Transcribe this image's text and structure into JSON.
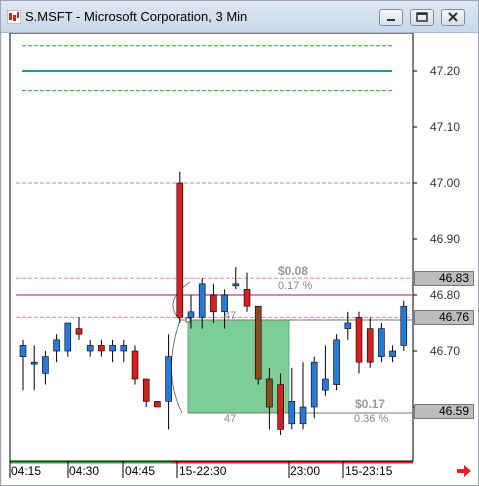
{
  "window": {
    "title": "S.MSFT - Microsoft Corporation, 3 Min"
  },
  "price_axis": {
    "labels": [
      "47.20",
      "47.10",
      "47.00",
      "46.90",
      "46.80",
      "46.70"
    ],
    "tags": {
      "upper": "46.83",
      "current": "46.76",
      "lower": "46.59"
    }
  },
  "time_axis": {
    "labels": [
      "04:15",
      "04:30",
      "04:45",
      "15-22:30",
      "23:00",
      "15-23:15"
    ]
  },
  "annotations": {
    "upper_move": "$0.08",
    "upper_pct": "0.17 %",
    "lower_move": "$0.17",
    "lower_pct": "0.36 %",
    "box_top": "47",
    "box_bottom": "47"
  },
  "colors": {
    "up": "#2878d8",
    "down": "#d42020",
    "dark_down": "#8b4a20",
    "green_line": "#22aa22",
    "teal_line": "#10a0a0",
    "pink_line": "#e080c8",
    "box_fill": "#7ccd97"
  },
  "chart_data": {
    "type": "candlestick",
    "ylim": [
      46.55,
      47.25
    ],
    "reference_lines": [
      {
        "price": 47.245,
        "color": "green",
        "style": "dashed"
      },
      {
        "price": 47.2,
        "color": "teal",
        "style": "solid"
      },
      {
        "price": 47.165,
        "color": "green",
        "style": "dashed"
      },
      {
        "price": 47.0,
        "color": "gray",
        "style": "dashed"
      },
      {
        "price": 46.83,
        "color": "pink",
        "style": "dashed"
      },
      {
        "price": 46.8,
        "color": "pink",
        "style": "solid"
      },
      {
        "price": 46.76,
        "color": "pink",
        "style": "dashed"
      }
    ],
    "candles": [
      {
        "o": 46.69,
        "h": 46.72,
        "l": 46.63,
        "c": 46.71
      },
      {
        "o": 46.68,
        "h": 46.71,
        "l": 46.63,
        "c": 46.68
      },
      {
        "o": 46.66,
        "h": 46.7,
        "l": 46.64,
        "c": 46.69
      },
      {
        "o": 46.7,
        "h": 46.73,
        "l": 46.68,
        "c": 46.72
      },
      {
        "o": 46.7,
        "h": 46.75,
        "l": 46.69,
        "c": 46.75
      },
      {
        "o": 46.74,
        "h": 46.76,
        "l": 46.72,
        "c": 46.73
      },
      {
        "o": 46.7,
        "h": 46.72,
        "l": 46.69,
        "c": 46.71
      },
      {
        "o": 46.71,
        "h": 46.72,
        "l": 46.69,
        "c": 46.7
      },
      {
        "o": 46.7,
        "h": 46.72,
        "l": 46.68,
        "c": 46.71
      },
      {
        "o": 46.7,
        "h": 46.72,
        "l": 46.68,
        "c": 46.71
      },
      {
        "o": 46.7,
        "h": 46.71,
        "l": 46.64,
        "c": 46.65
      },
      {
        "o": 46.65,
        "h": 46.65,
        "l": 46.6,
        "c": 46.61
      },
      {
        "o": 46.61,
        "h": 46.61,
        "l": 46.6,
        "c": 46.6
      },
      {
        "o": 46.61,
        "h": 46.73,
        "l": 46.56,
        "c": 46.69
      },
      {
        "o": 47.0,
        "h": 47.02,
        "l": 46.75,
        "c": 46.76
      },
      {
        "o": 46.76,
        "h": 46.8,
        "l": 46.74,
        "c": 46.77
      },
      {
        "o": 46.76,
        "h": 46.83,
        "l": 46.74,
        "c": 46.82
      },
      {
        "o": 46.8,
        "h": 46.82,
        "l": 46.75,
        "c": 46.77
      },
      {
        "o": 46.77,
        "h": 46.81,
        "l": 46.74,
        "c": 46.8
      },
      {
        "o": 46.82,
        "h": 46.85,
        "l": 46.81,
        "c": 46.82
      },
      {
        "o": 46.81,
        "h": 46.84,
        "l": 46.77,
        "c": 46.78
      },
      {
        "o": 46.78,
        "h": 46.78,
        "l": 46.64,
        "c": 46.65
      },
      {
        "o": 46.65,
        "h": 46.67,
        "l": 46.56,
        "c": 46.6
      },
      {
        "o": 46.64,
        "h": 46.66,
        "l": 46.55,
        "c": 46.56
      },
      {
        "o": 46.57,
        "h": 46.67,
        "l": 46.56,
        "c": 46.61
      },
      {
        "o": 46.57,
        "h": 46.68,
        "l": 46.56,
        "c": 46.6
      },
      {
        "o": 46.6,
        "h": 46.69,
        "l": 46.58,
        "c": 46.68
      },
      {
        "o": 46.63,
        "h": 46.71,
        "l": 46.62,
        "c": 46.65
      },
      {
        "o": 46.64,
        "h": 46.73,
        "l": 46.63,
        "c": 46.72
      },
      {
        "o": 46.74,
        "h": 46.77,
        "l": 46.72,
        "c": 46.75
      },
      {
        "o": 46.76,
        "h": 46.77,
        "l": 46.66,
        "c": 46.68
      },
      {
        "o": 46.74,
        "h": 46.76,
        "l": 46.67,
        "c": 46.68
      },
      {
        "o": 46.69,
        "h": 46.75,
        "l": 46.68,
        "c": 46.74
      },
      {
        "o": 46.69,
        "h": 46.71,
        "l": 46.68,
        "c": 46.7
      },
      {
        "o": 46.71,
        "h": 46.79,
        "l": 46.7,
        "c": 46.78
      }
    ]
  }
}
